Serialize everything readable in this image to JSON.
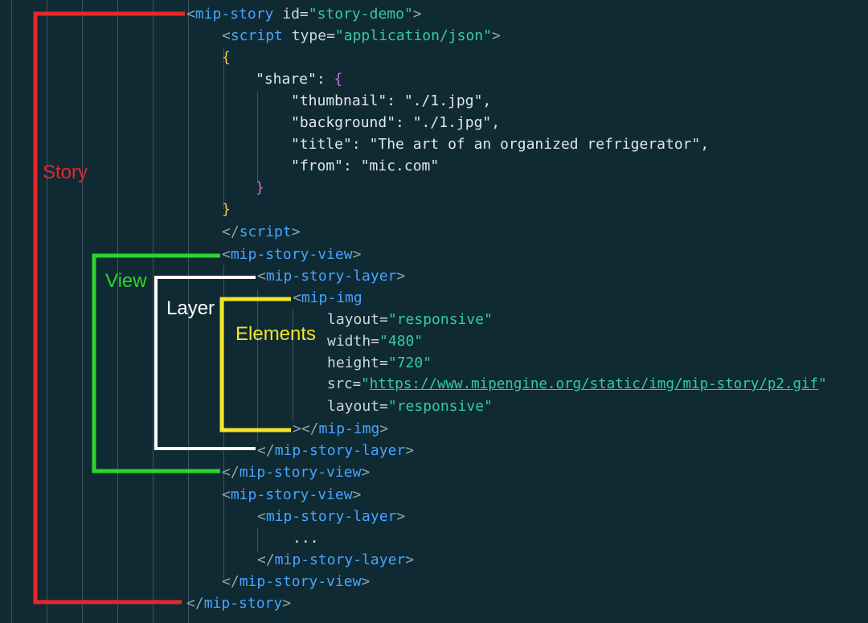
{
  "code": {
    "l1": {
      "open": "<",
      "tag": "mip-story",
      "attr": "id=",
      "val": "\"story-demo\"",
      "close": ">"
    },
    "l2": {
      "open": "<",
      "tag": "script",
      "attr": "type=",
      "val": "\"application/json\"",
      "close": ">"
    },
    "l3": {
      "brace": "{"
    },
    "l4": {
      "key": "\"share\": ",
      "brace": "{"
    },
    "l5": {
      "text": "\"thumbnail\": \"./1.jpg\","
    },
    "l6": {
      "text": "\"background\": \"./1.jpg\","
    },
    "l7": {
      "text": "\"title\": \"The art of an organized refrigerator\","
    },
    "l8": {
      "text": "\"from\": \"mic.com\""
    },
    "l9": {
      "brace": "}"
    },
    "l10": {
      "brace": "}"
    },
    "l11": {
      "open": "</",
      "tag": "script",
      "close": ">"
    },
    "l12": {
      "open": "<",
      "tag": "mip-story-view",
      "close": ">"
    },
    "l13": {
      "open": "<",
      "tag": "mip-story-layer",
      "close": ">"
    },
    "l14": {
      "open": "<",
      "tag": "mip-img"
    },
    "l15": {
      "attr": "layout=",
      "val": "\"responsive\""
    },
    "l16": {
      "attr": "width=",
      "val": "\"480\""
    },
    "l17": {
      "attr": "height=",
      "val": "\"720\""
    },
    "l18": {
      "attr": "src=",
      "q1": "\"",
      "url": "https://www.mipengine.org/static/img/mip-story/p2.gif",
      "q2": "\""
    },
    "l19": {
      "attr": "layout=",
      "val": "\"responsive\""
    },
    "l20": {
      "open": "></",
      "tag": "mip-img",
      "close": ">"
    },
    "l21": {
      "open": "</",
      "tag": "mip-story-layer",
      "close": ">"
    },
    "l22": {
      "open": "</",
      "tag": "mip-story-view",
      "close": ">"
    },
    "l23": {
      "open": "<",
      "tag": "mip-story-view",
      "close": ">"
    },
    "l24": {
      "open": "<",
      "tag": "mip-story-layer",
      "close": ">"
    },
    "l25": {
      "text": "..."
    },
    "l26": {
      "open": "</",
      "tag": "mip-story-layer",
      "close": ">"
    },
    "l27": {
      "open": "</",
      "tag": "mip-story-view",
      "close": ">"
    },
    "l28": {
      "open": "</",
      "tag": "mip-story",
      "close": ">"
    }
  },
  "annotations": {
    "story": {
      "label": "Story",
      "color": "#e8262b"
    },
    "view": {
      "label": "View",
      "color": "#2bd62b"
    },
    "layer": {
      "label": "Layer",
      "color": "#ffffff"
    },
    "elements": {
      "label": "Elements",
      "color": "#f0e52a"
    }
  }
}
